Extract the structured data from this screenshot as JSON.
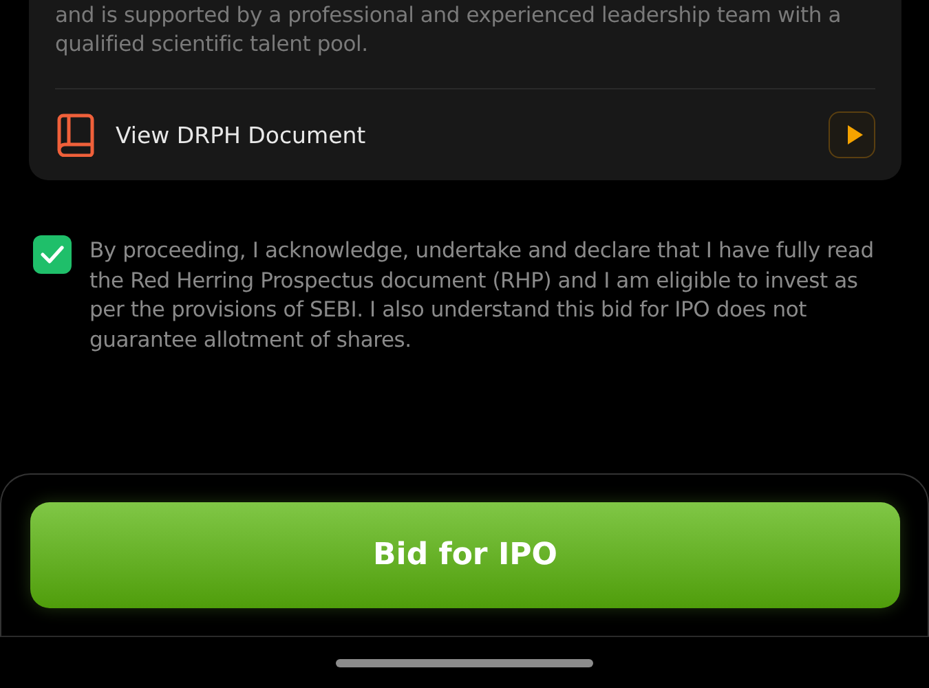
{
  "about_card": {
    "description_lines": [
      "and is supported by a professional and experienced leadership team with a",
      "qualified scientific talent pool."
    ],
    "document_link": {
      "label": "View DRPH Document"
    }
  },
  "consent": {
    "checked": true,
    "text": "By proceeding, I acknowledge, undertake and declare that I have fully read the Red Herring Prospectus document (RHP) and I am eligible to invest as per the provisions of SEBI. I also understand this bid for IPO does not guarantee allotment of shares."
  },
  "bid_button": {
    "label": "Bid for IPO"
  }
}
